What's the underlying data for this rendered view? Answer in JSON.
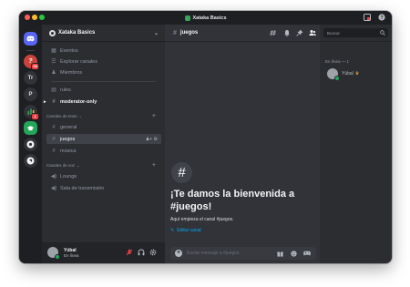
{
  "window": {
    "title": "Xataka Basics"
  },
  "rail": {
    "servers": [
      {
        "name": "discord-home-icon",
        "label": ""
      },
      {
        "name": "server-avatar-icon",
        "label": "",
        "badge": "28"
      },
      {
        "name": "server-tr",
        "label": "Tr"
      },
      {
        "name": "server-p",
        "label": "P"
      },
      {
        "name": "server-chart",
        "label": "",
        "badge": "1"
      },
      {
        "name": "server-graduation",
        "label": ""
      },
      {
        "name": "server-white-1",
        "label": ""
      },
      {
        "name": "server-white-2",
        "label": ""
      }
    ]
  },
  "sidebar": {
    "guild_name": "Xataka Basics",
    "top_items": [
      {
        "icon": "calendar-icon",
        "label": "Eventos"
      },
      {
        "icon": "browse-channels-icon",
        "label": "Explorar canales"
      },
      {
        "icon": "members-icon",
        "label": "Miembros"
      }
    ],
    "rules_label": "rules",
    "moderator_label": "moderator-only",
    "text_category": "Canales de texto",
    "text_channels": [
      "general",
      "juegos",
      "música"
    ],
    "voice_category": "Canales de voz",
    "voice_channels": [
      "Lounge",
      "Sala de transmisión"
    ]
  },
  "user": {
    "name": "Yúbal",
    "status": "En línea"
  },
  "channel": {
    "name": "juegos",
    "welcome_title": "¡Te damos la bienvenida a #juegos!",
    "welcome_desc": "Aquí empieza el canal #juegos.",
    "edit_label": "Editar canal",
    "composer_placeholder": "Enviar mensaje a #juegos"
  },
  "members": {
    "search_placeholder": "Buscar",
    "online_header": "En línea — 1",
    "list": [
      {
        "name": "Yúbal"
      }
    ]
  },
  "colors": {
    "accent": "#5865f2",
    "online": "#23a55a",
    "link": "#00a8fc",
    "badge": "#f23f43"
  }
}
